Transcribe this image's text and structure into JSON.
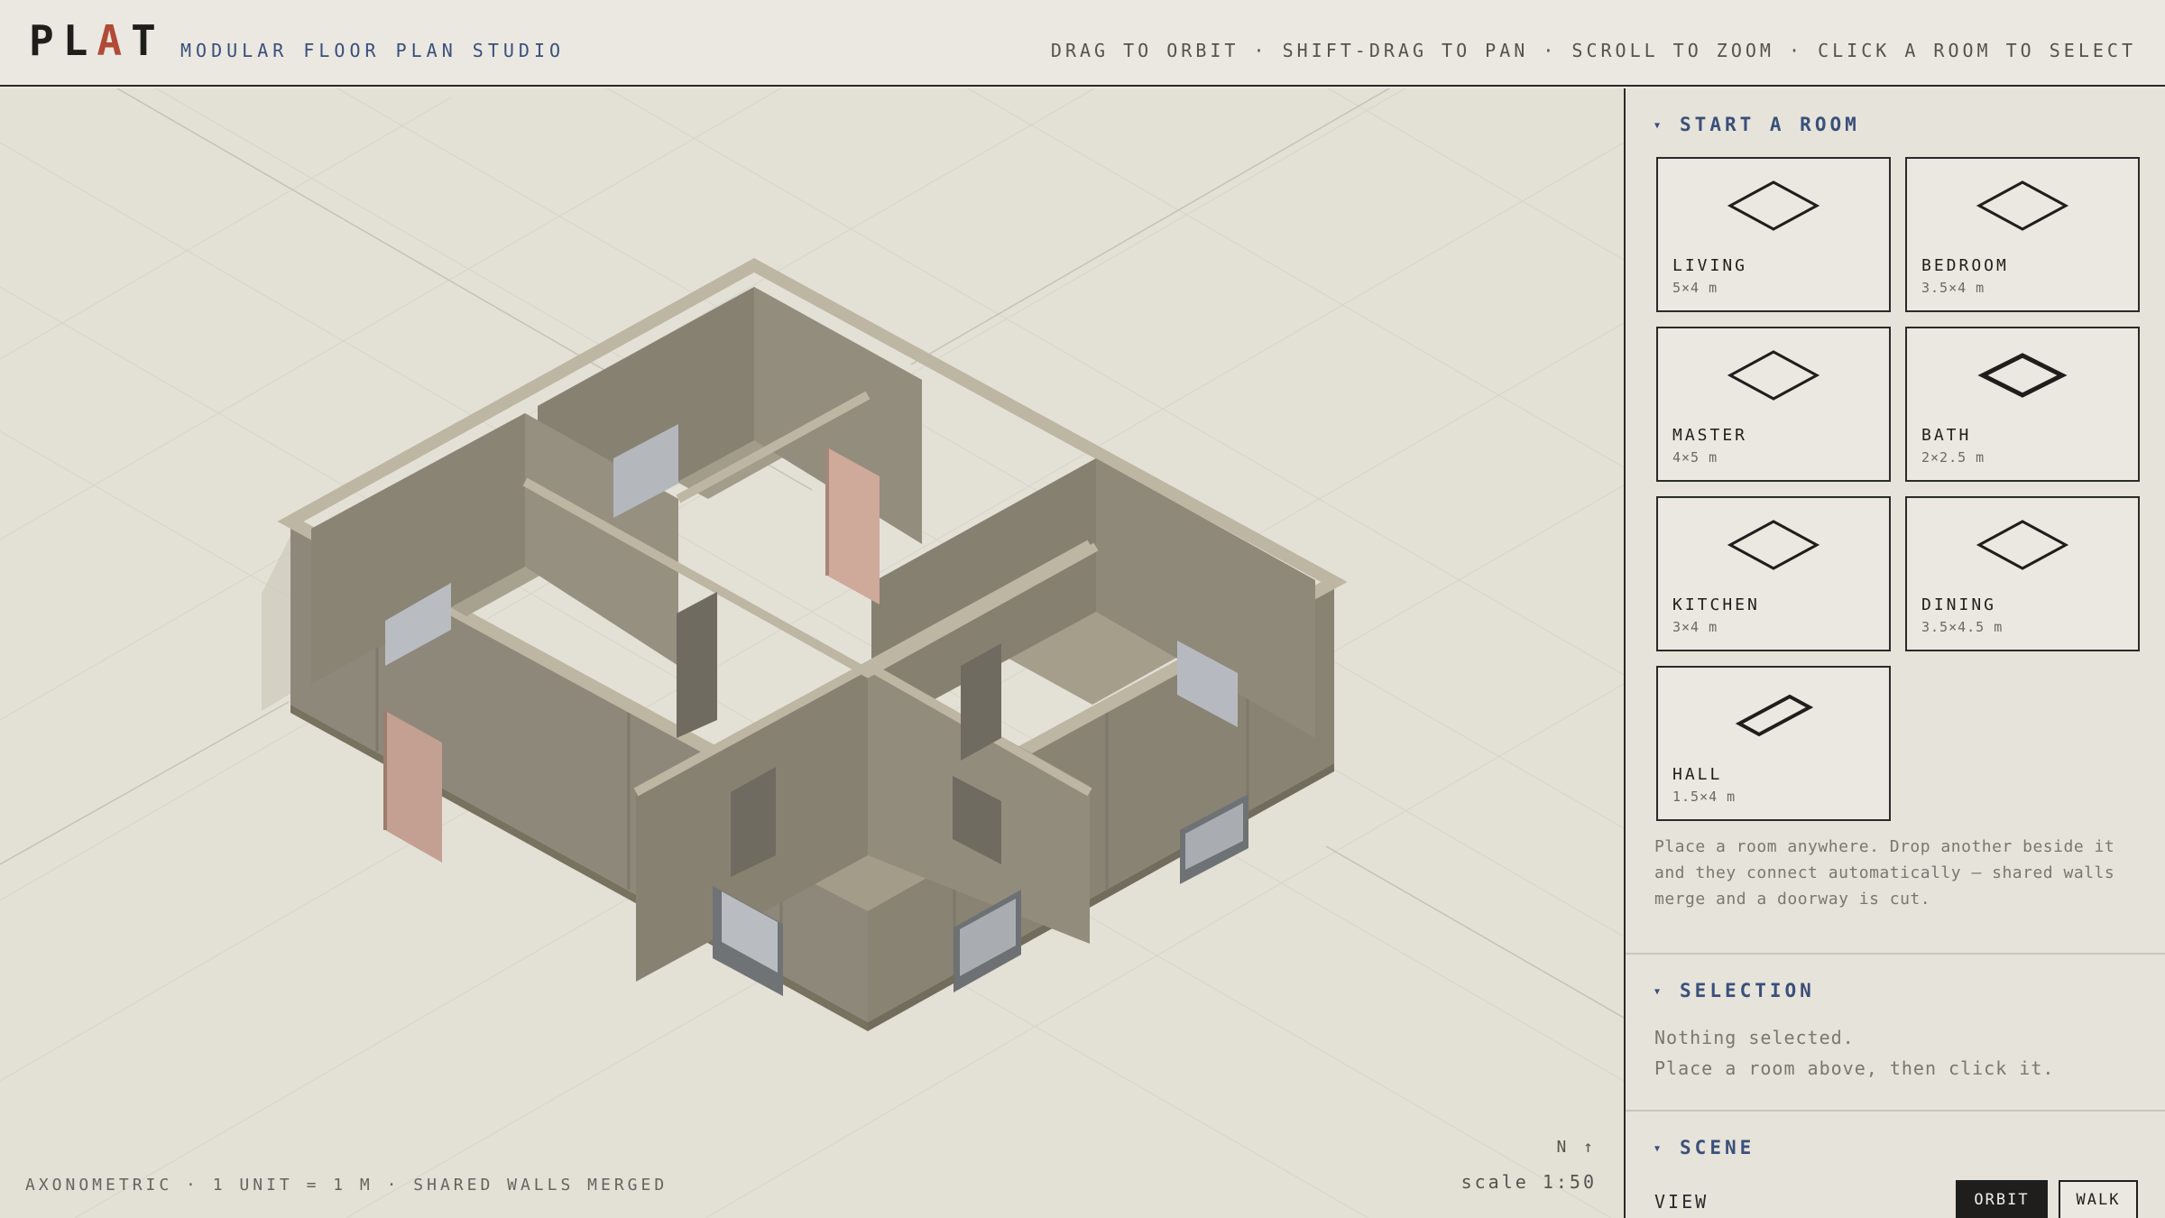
{
  "header": {
    "logo_start": "PL",
    "logo_accent": "A",
    "logo_end": "T",
    "subtitle": "MODULAR FLOOR PLAN STUDIO",
    "hint": "DRAG TO ORBIT · SHIFT-DRAG TO PAN · SCROLL TO ZOOM · CLICK A ROOM TO SELECT"
  },
  "viewport": {
    "footnote": "AXONOMETRIC · 1 UNIT = 1 M · SHARED WALLS MERGED",
    "compass": "N ↑",
    "scale": "scale 1:50"
  },
  "panel": {
    "start_title": "START A ROOM",
    "rooms": [
      {
        "name": "LIVING",
        "dims": "5×4 m"
      },
      {
        "name": "BEDROOM",
        "dims": "3.5×4 m"
      },
      {
        "name": "MASTER",
        "dims": "4×5 m"
      },
      {
        "name": "BATH",
        "dims": "2×2.5 m"
      },
      {
        "name": "KITCHEN",
        "dims": "3×4 m"
      },
      {
        "name": "DINING",
        "dims": "3.5×4.5 m"
      },
      {
        "name": "HALL",
        "dims": "1.5×4 m"
      }
    ],
    "help": "Place a room anywhere. Drop another beside it and they connect automatically — shared walls merge and a doorway is cut.",
    "selection_title": "SELECTION",
    "selection_line1": "Nothing selected.",
    "selection_line2": "Place a room above, then click it.",
    "scene_title": "SCENE",
    "view_label": "VIEW",
    "view_options": [
      "ORBIT",
      "WALK"
    ],
    "view_selected": "ORBIT"
  },
  "colors": {
    "accent_logo": "#b14a36",
    "section_blue": "#3a4f7a",
    "wall": "#8e887a",
    "floor": "#a6a08e",
    "door": "#c9a393",
    "window": "#b8bcc2"
  },
  "icons": {
    "section_marker": "triangle-down-icon",
    "room_card": "floor-plan-diamond-icon",
    "compass": "north-arrow-icon"
  }
}
